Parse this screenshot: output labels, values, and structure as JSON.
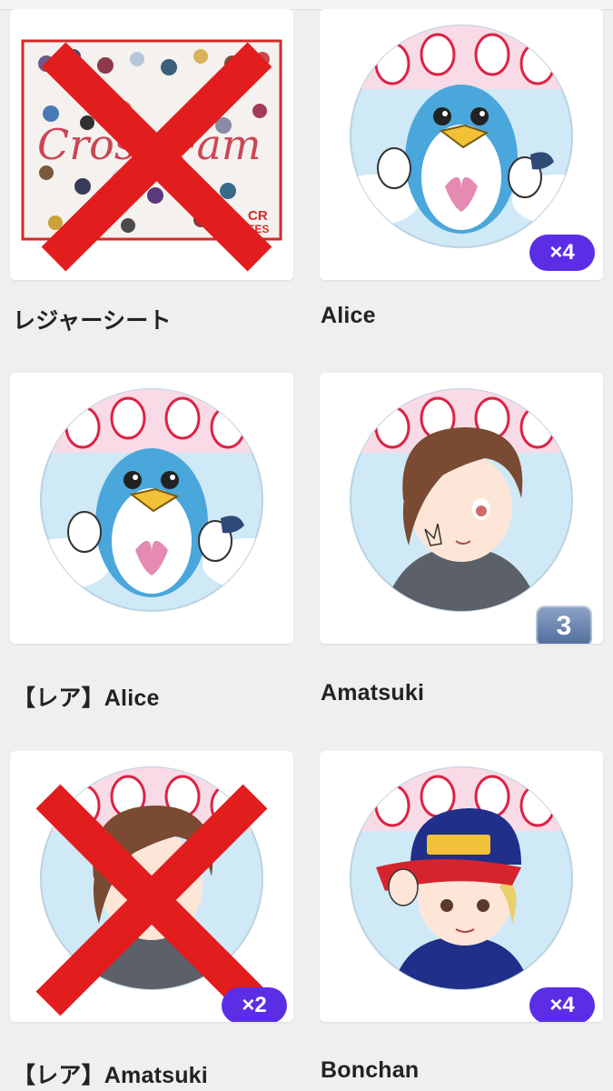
{
  "items": [
    {
      "title": "レジャーシート",
      "crossed": true,
      "art": "sheet-icon"
    },
    {
      "title": "Alice",
      "crossed": false,
      "count": "×4",
      "art": "penguin-icon"
    },
    {
      "title": "【レア】Alice",
      "crossed": false,
      "art": "penguin-icon"
    },
    {
      "title": "Amatsuki",
      "crossed": false,
      "count": "3",
      "count_style": "keycap",
      "art": "brown-hair-character-icon"
    },
    {
      "title": "【レア】Amatsuki",
      "crossed": true,
      "count": "×2",
      "art": "brown-hair-character-icon"
    },
    {
      "title": "Bonchan",
      "crossed": false,
      "count": "×4",
      "art": "cap-character-icon"
    }
  ],
  "colors": {
    "badge": "#5b2ee6",
    "cross": "#e21d1d",
    "background": "#efefef"
  }
}
